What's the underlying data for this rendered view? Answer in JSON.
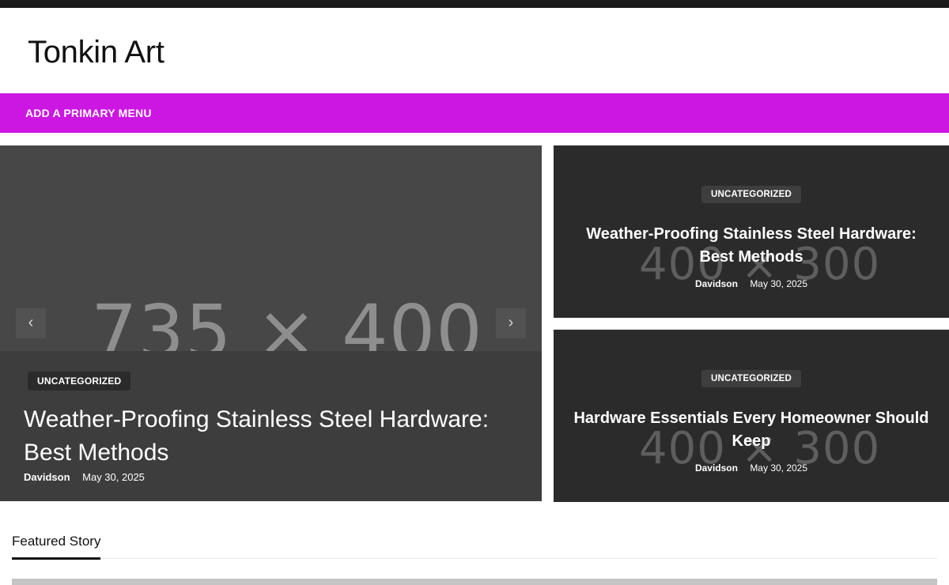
{
  "site": {
    "title": "Tonkin Art"
  },
  "nav": {
    "menu_label": "ADD A PRIMARY MENU"
  },
  "slider": {
    "placeholder": "735 × 400",
    "prev_icon": "‹",
    "next_icon": "›",
    "category": "UNCATEGORIZED",
    "title": "Weather-Proofing Stainless Steel Hardware: Best Methods",
    "author": "Davidson",
    "date": "May 30, 2025"
  },
  "cards": [
    {
      "placeholder": "400 × 300",
      "category": "UNCATEGORIZED",
      "title": "Weather-Proofing Stainless Steel Hardware: Best Methods",
      "author": "Davidson",
      "date": "May 30, 2025"
    },
    {
      "placeholder": "400 × 300",
      "category": "UNCATEGORIZED",
      "title": "Hardware Essentials Every Homeowner Should Keep",
      "author": "Davidson",
      "date": "May 30, 2025"
    }
  ],
  "featured": {
    "tab_label": "Featured Story"
  },
  "colors": {
    "accent": "#cc17e3",
    "dark": "#2b2b2b"
  }
}
